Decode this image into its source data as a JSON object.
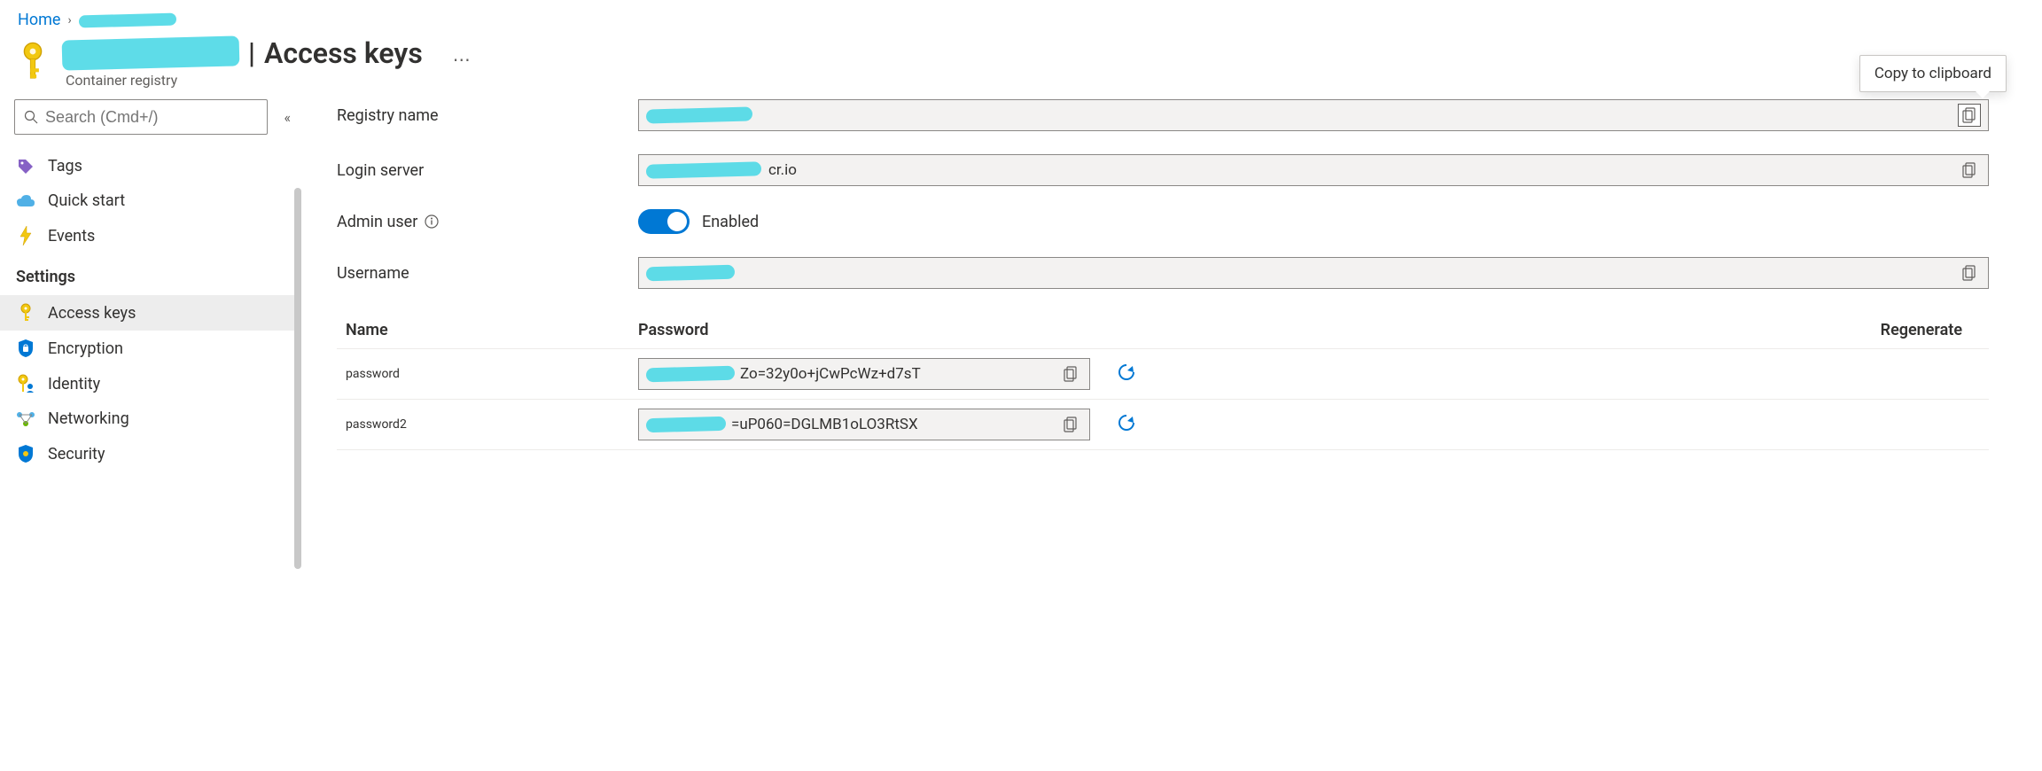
{
  "breadcrumb": {
    "home": "Home",
    "current": "[redacted]"
  },
  "title": {
    "resource_name": "[redacted]",
    "page": "Access keys",
    "subtitle": "Container registry"
  },
  "sidebar": {
    "search_placeholder": "Search (Cmd+/)",
    "items": [
      {
        "label": "Tags"
      },
      {
        "label": "Quick start"
      },
      {
        "label": "Events"
      }
    ],
    "settings_header": "Settings",
    "settings": [
      {
        "label": "Access keys"
      },
      {
        "label": "Encryption"
      },
      {
        "label": "Identity"
      },
      {
        "label": "Networking"
      },
      {
        "label": "Security"
      }
    ]
  },
  "fields": {
    "registry_name": {
      "label": "Registry name",
      "value": "[redacted]"
    },
    "login_server": {
      "label": "Login server",
      "value_suffix": "cr.io"
    },
    "admin_user": {
      "label": "Admin user",
      "status": "Enabled"
    },
    "username": {
      "label": "Username",
      "value": "[redacted]"
    }
  },
  "password_table": {
    "headers": {
      "name": "Name",
      "password": "Password",
      "regenerate": "Regenerate"
    },
    "rows": [
      {
        "name": "password",
        "value_suffix": "Zo=32y0o+jCwPcWz+d7sT"
      },
      {
        "name": "password2",
        "value_suffix": "=uP060=DGLMB1oLO3RtSX"
      }
    ]
  },
  "tooltip": {
    "copy": "Copy to clipboard"
  }
}
